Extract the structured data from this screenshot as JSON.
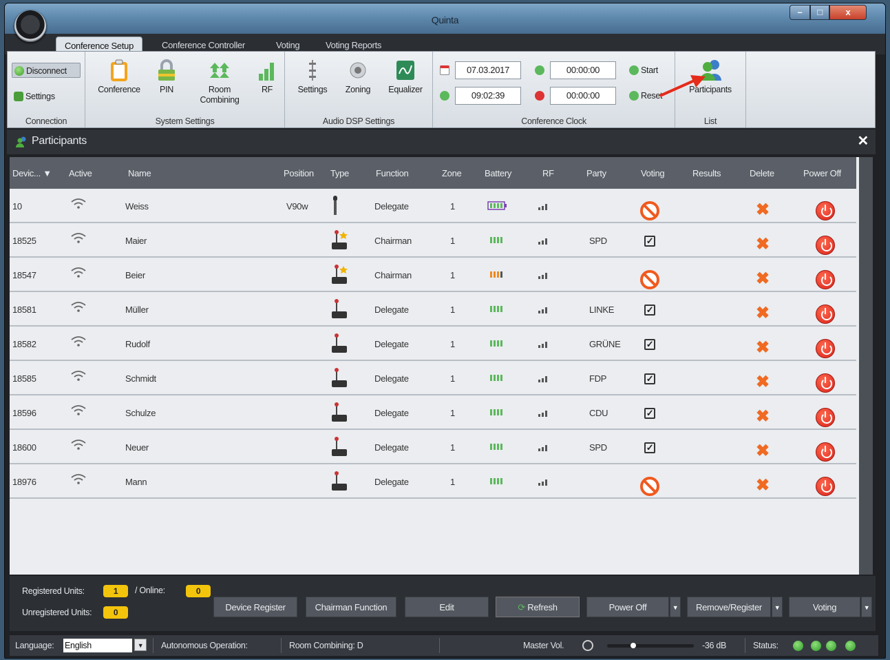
{
  "window": {
    "title": "Quinta"
  },
  "tabs": [
    "Conference Setup",
    "Conference Controller",
    "Voting",
    "Voting Reports"
  ],
  "ribbon": {
    "connection": {
      "disconnect": "Disconnect",
      "settings": "Settings",
      "label": "Connection"
    },
    "system": {
      "conference": "Conference",
      "pin": "PIN",
      "room_combining": "Room Combining",
      "rf": "RF",
      "label": "System Settings"
    },
    "audio": {
      "settings": "Settings",
      "zoning": "Zoning",
      "equalizer": "Equalizer",
      "label": "Audio DSP Settings"
    },
    "clock": {
      "date": "07.03.2017",
      "time": "09:02:39",
      "timer1": "00:00:00",
      "timer2": "00:00:00",
      "start": "Start",
      "reset": "Reset",
      "label": "Conference Clock"
    },
    "list": {
      "participants": "Participants",
      "label": "List"
    }
  },
  "panel": {
    "title": "Participants",
    "close": "✕"
  },
  "columns": [
    "Devic... ▼",
    "Active",
    "Name",
    "Position",
    "Type",
    "Function",
    "Zone",
    "Battery",
    "RF",
    "Party",
    "Voting",
    "Results",
    "Delete",
    "Power Off"
  ],
  "rows": [
    {
      "device": "10",
      "name": "Weiss",
      "position": "V90w",
      "type": "handheld",
      "function": "Delegate",
      "zone": "1",
      "battery": "outline",
      "party": "",
      "voting": "no"
    },
    {
      "device": "18525",
      "name": "Maier",
      "position": "",
      "type": "chairman",
      "function": "Chairman",
      "zone": "1",
      "battery": "green",
      "party": "SPD",
      "voting": "yes"
    },
    {
      "device": "18547",
      "name": "Beier",
      "position": "",
      "type": "chairman",
      "function": "Chairman",
      "zone": "1",
      "battery": "orange",
      "party": "",
      "voting": "no"
    },
    {
      "device": "18581",
      "name": "Müller",
      "position": "",
      "type": "delegate",
      "function": "Delegate",
      "zone": "1",
      "battery": "green",
      "party": "LINKE",
      "voting": "yes"
    },
    {
      "device": "18582",
      "name": "Rudolf",
      "position": "",
      "type": "delegate",
      "function": "Delegate",
      "zone": "1",
      "battery": "green",
      "party": "GRÜNE",
      "voting": "yes"
    },
    {
      "device": "18585",
      "name": "Schmidt",
      "position": "",
      "type": "delegate",
      "function": "Delegate",
      "zone": "1",
      "battery": "green",
      "party": "FDP",
      "voting": "yes"
    },
    {
      "device": "18596",
      "name": "Schulze",
      "position": "",
      "type": "delegate",
      "function": "Delegate",
      "zone": "1",
      "battery": "green",
      "party": "CDU",
      "voting": "yes"
    },
    {
      "device": "18600",
      "name": "Neuer",
      "position": "",
      "type": "delegate",
      "function": "Delegate",
      "zone": "1",
      "battery": "green",
      "party": "SPD",
      "voting": "yes"
    },
    {
      "device": "18976",
      "name": "Mann",
      "position": "",
      "type": "delegate",
      "function": "Delegate",
      "zone": "1",
      "battery": "green",
      "party": "",
      "voting": "no"
    }
  ],
  "footer": {
    "registered_label": "Registered Units:",
    "registered": "1",
    "online_label": "/ Online:",
    "online": "0",
    "unregistered_label": "Unregistered Units:",
    "unregistered": "0",
    "buttons": [
      "Device Register",
      "Chairman Function",
      "Edit",
      "Refresh",
      "Power Off",
      "Remove/Register",
      "Voting"
    ]
  },
  "status": {
    "language_label": "Language:",
    "language": "English",
    "autonomous": "Autonomous Operation:",
    "room_combining": "Room Combining: D",
    "master_vol_label": "Master Vol.",
    "master_vol": "-36 dB",
    "status_label": "Status:"
  },
  "colors": {
    "accent_green": "#5cb85c",
    "delete": "#f06a22",
    "power": "#d8221a",
    "badge": "#f3c40c"
  }
}
